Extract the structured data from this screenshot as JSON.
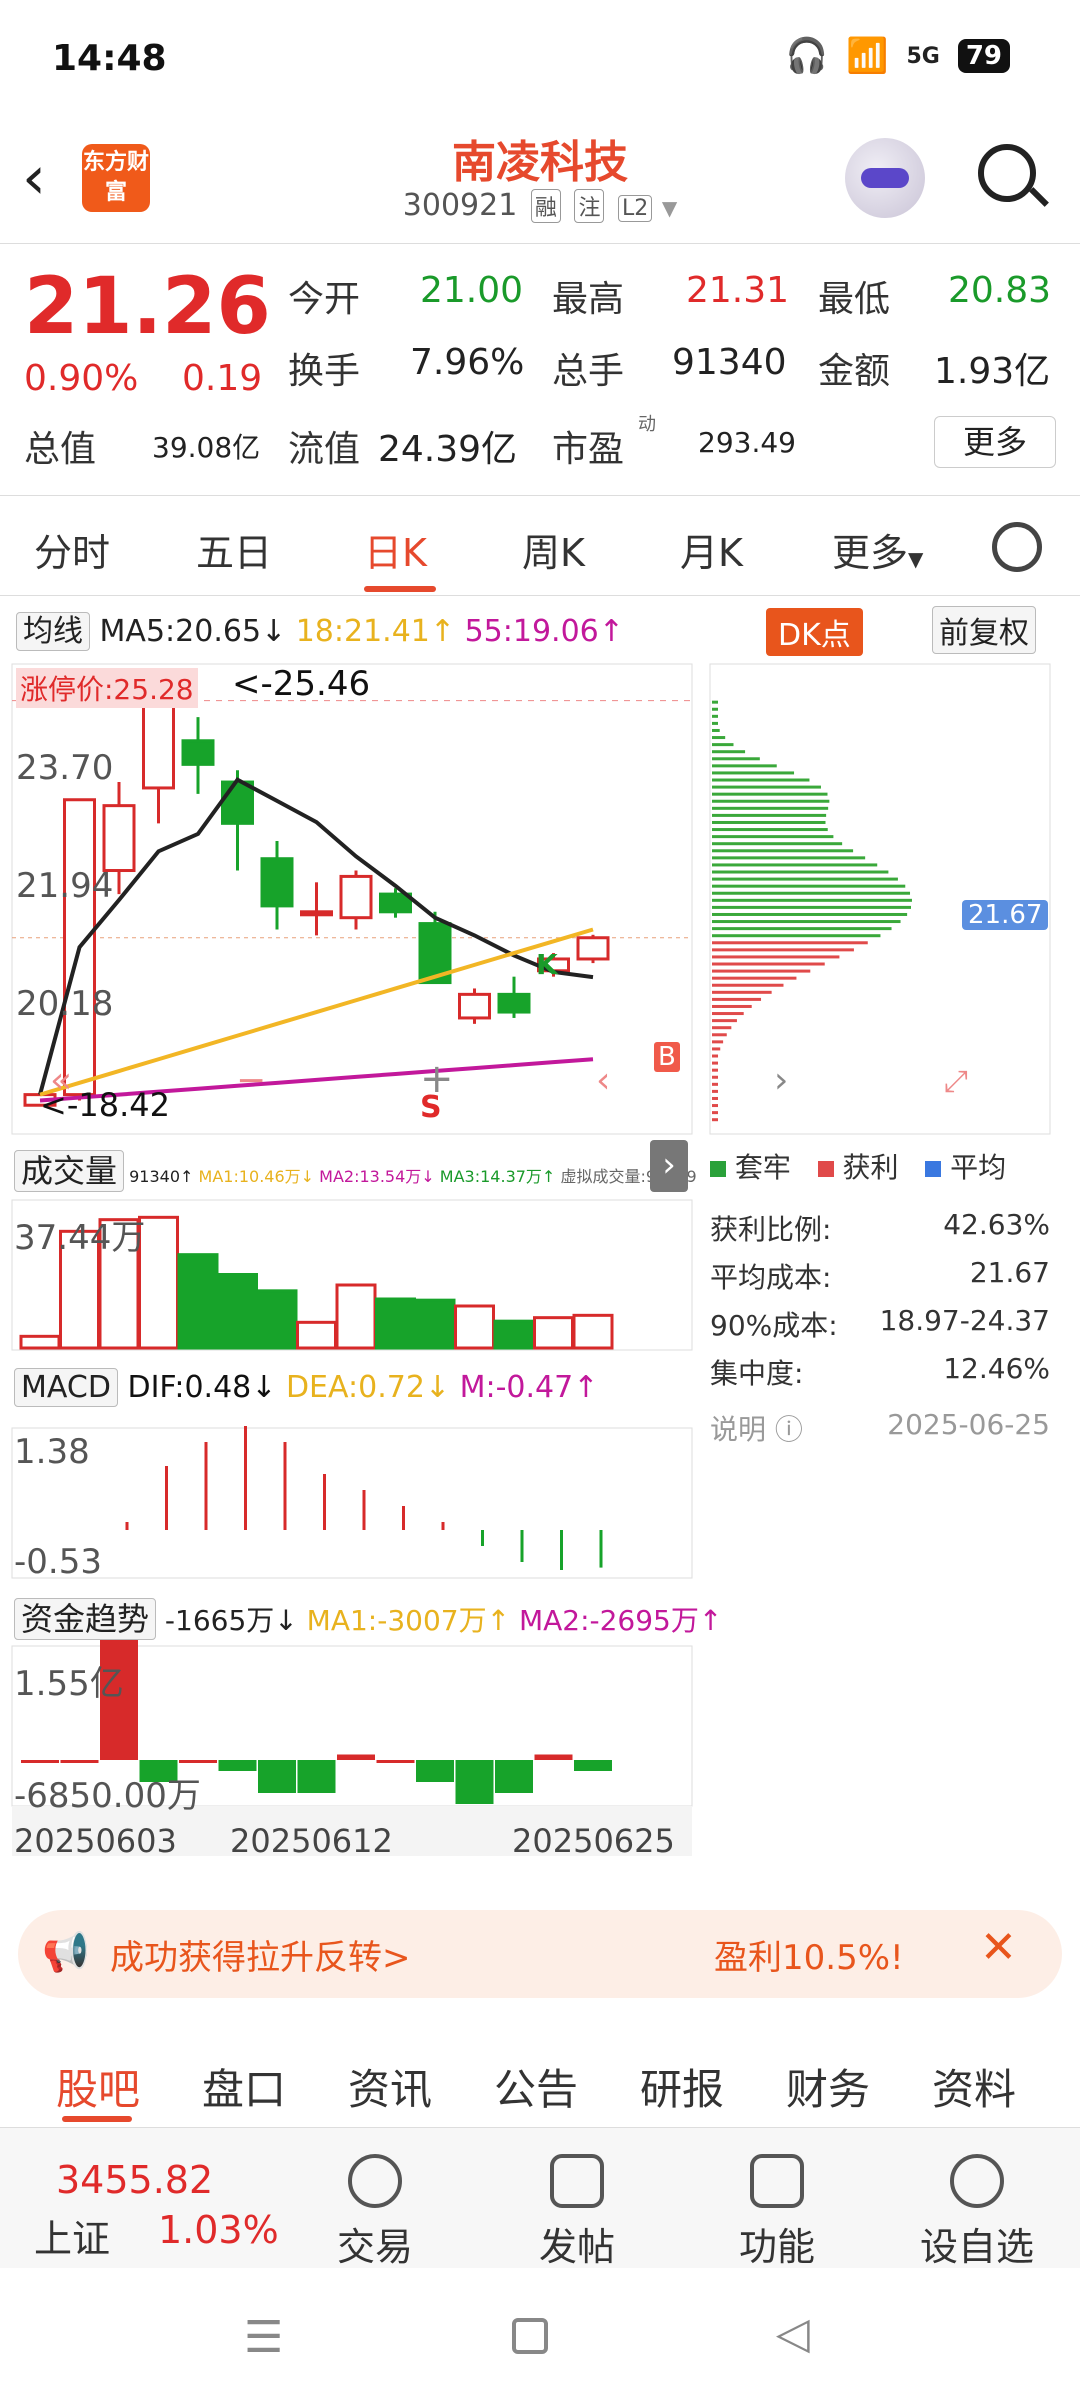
{
  "status": {
    "time": "14:48",
    "network": "5G",
    "battery": "79"
  },
  "header": {
    "back": "‹",
    "logo": "东方财富",
    "title": "南凌科技",
    "code": "300921",
    "tags": [
      "融",
      "注",
      "L2"
    ]
  },
  "quote": {
    "price": "21.26",
    "pct": "0.90%",
    "chg": "0.19",
    "open_l": "今开",
    "open": "21.00",
    "high_l": "最高",
    "high": "21.31",
    "low_l": "最低",
    "low": "20.83",
    "turn_l": "换手",
    "turn": "7.96%",
    "vol_l": "总手",
    "vol": "91340",
    "amt_l": "金额",
    "amt": "1.93亿",
    "mcap_l": "总值",
    "mcap": "39.08亿",
    "fcap_l": "流值",
    "fcap": "24.39亿",
    "pe_l": "市盈",
    "pe_sup": "动",
    "pe": "293.49",
    "more": "更多"
  },
  "tabs": [
    "分时",
    "五日",
    "日K",
    "周K",
    "月K",
    "更多"
  ],
  "ma": {
    "label": "均线",
    "ma5": "MA5:20.65↓",
    "ma18": "18:21.41↑",
    "ma55": "55:19.06↑",
    "dk": "DK点",
    "fq": "前复权"
  },
  "kchart": {
    "yticks": [
      "23.70",
      "21.94",
      "20.18"
    ],
    "top_label": "25.46",
    "high_note": "<-25.46",
    "limit": "涨停价:25.28",
    "low_note": "<-18.42",
    "bottom_label": "18.42",
    "k": "K",
    "b": "B",
    "s": "S",
    "price_line": "21.67"
  },
  "chart_data": {
    "type": "candlestick",
    "dates": [
      "20250603",
      "20250612",
      "20250625"
    ],
    "candles": [
      [
        18.42,
        18.6,
        18.4,
        18.6
      ],
      [
        18.6,
        23.6,
        18.5,
        23.6
      ],
      [
        22.4,
        23.9,
        22.0,
        23.5
      ],
      [
        23.8,
        25.46,
        23.2,
        25.2
      ],
      [
        24.6,
        25.0,
        23.7,
        24.2
      ],
      [
        23.9,
        24.1,
        22.4,
        23.2
      ],
      [
        22.6,
        22.9,
        21.4,
        21.8
      ],
      [
        21.7,
        22.2,
        21.3,
        21.7
      ],
      [
        21.6,
        22.4,
        21.4,
        22.3
      ],
      [
        22.0,
        22.1,
        21.6,
        21.7
      ],
      [
        21.5,
        21.7,
        20.5,
        20.5
      ],
      [
        19.9,
        20.4,
        19.8,
        20.3
      ],
      [
        20.3,
        20.6,
        19.9,
        20.0
      ],
      [
        20.7,
        21.0,
        20.6,
        20.9
      ],
      [
        20.9,
        21.31,
        20.83,
        21.26
      ]
    ]
  },
  "volume": {
    "label": "成交量",
    "info": "91340↑",
    "ma1": "MA1:10.46万↓",
    "ma2": "MA2:13.54万↓",
    "ma3": "MA3:14.37万↑",
    "virtual": "虚拟成交量:99949",
    "ytop": "37.44万"
  },
  "macd": {
    "label": "MACD",
    "dif": "DIF:0.48↓",
    "dea": "DEA:0.72↓",
    "m": "M:-0.47↑",
    "ytop": "1.38",
    "ybot": "-0.53"
  },
  "fund": {
    "label": "资金趋势",
    "val": "-1665万↓",
    "ma1": "MA1:-3007万↑",
    "ma2": "MA2:-2695万↑",
    "ytop": "1.55亿",
    "ybot": "-6850.00万"
  },
  "dates": [
    "20250603",
    "20250612",
    "20250625"
  ],
  "chips": {
    "legend": [
      "套牢",
      "获利",
      "平均"
    ],
    "rows": [
      {
        "k": "获利比例:",
        "v": "42.63%"
      },
      {
        "k": "平均成本:",
        "v": "21.67"
      },
      {
        "k": "90%成本:",
        "v": "18.97-24.37"
      },
      {
        "k": "集中度:",
        "v": "12.46%"
      }
    ],
    "note": "说明",
    "date": "2025-06-25"
  },
  "banner": {
    "left": "成功获得拉升反转>",
    "right": "盈利10.5%!"
  },
  "subtabs": [
    "股吧",
    "盘口",
    "资讯",
    "公告",
    "研报",
    "财务",
    "资料"
  ],
  "bottom": {
    "index_val": "3455.82",
    "index_name": "上证",
    "index_pct": "1.03%",
    "items": [
      "交易",
      "发帖",
      "功能",
      "设自选"
    ]
  }
}
